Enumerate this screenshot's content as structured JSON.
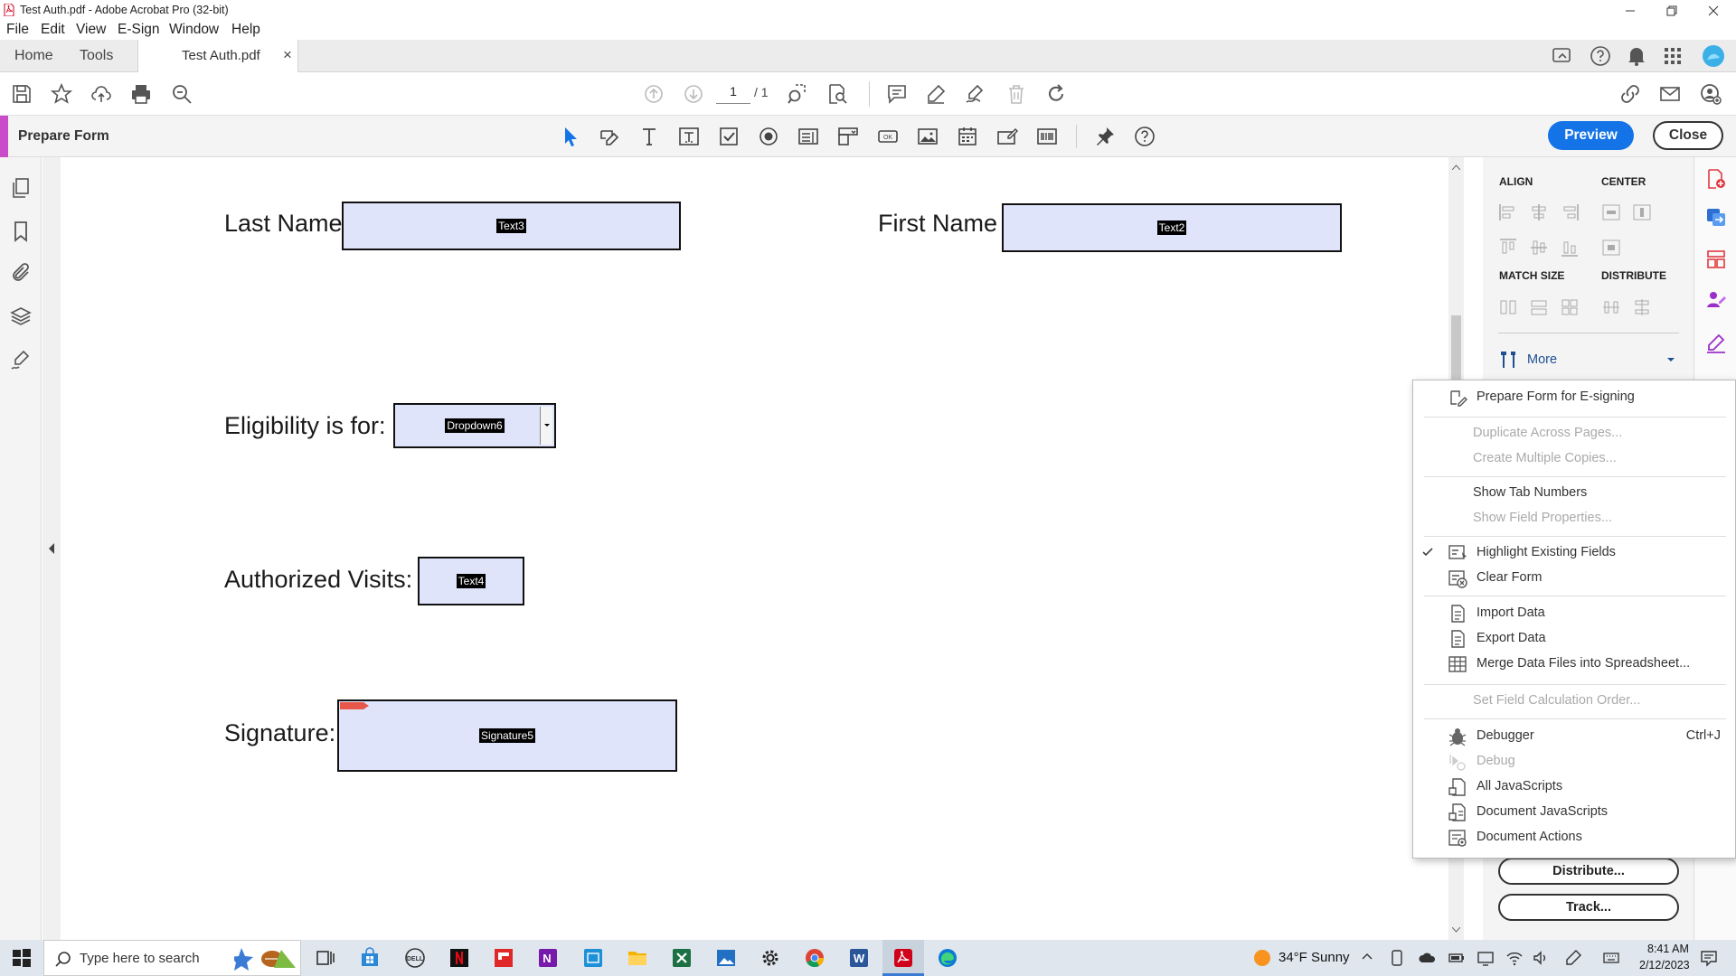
{
  "window": {
    "title": "Test Auth.pdf - Adobe Acrobat Pro (32-bit)"
  },
  "menubar": {
    "items": [
      "File",
      "Edit",
      "View",
      "E-Sign",
      "Window",
      "Help"
    ]
  },
  "tabs": {
    "home": "Home",
    "tools": "Tools",
    "document": "Test Auth.pdf",
    "close_glyph": "×"
  },
  "toolbar": {
    "page_current": "1",
    "page_total": "/ 1"
  },
  "prepare_form": {
    "label": "Prepare Form",
    "preview": "Preview",
    "close": "Close"
  },
  "document": {
    "fields": [
      {
        "label": "Last Name",
        "name": "Text3"
      },
      {
        "label": "First Name",
        "name": "Text2"
      },
      {
        "label": "Eligibility is for:",
        "name": "Dropdown6"
      },
      {
        "label": "Authorized Visits:",
        "name": "Text4"
      },
      {
        "label": "Signature:",
        "name": "Signature5"
      }
    ]
  },
  "right_panel": {
    "align": "ALIGN",
    "center": "CENTER",
    "match_size": "MATCH SIZE",
    "distribute": "DISTRIBUTE",
    "more": "More",
    "distribute_button": "Distribute...",
    "track_button": "Track..."
  },
  "menu": {
    "items": [
      {
        "label": "Prepare Form for E-signing",
        "enabled": true
      },
      {
        "label": "Duplicate Across Pages...",
        "enabled": false
      },
      {
        "label": "Create Multiple Copies...",
        "enabled": false
      },
      {
        "label": "Show Tab Numbers",
        "enabled": true
      },
      {
        "label": "Show Field Properties...",
        "enabled": false
      },
      {
        "label": "Highlight Existing Fields",
        "enabled": true,
        "checked": true
      },
      {
        "label": "Clear Form",
        "enabled": true
      },
      {
        "label": "Import Data",
        "enabled": true
      },
      {
        "label": "Export Data",
        "enabled": true
      },
      {
        "label": "Merge Data Files into Spreadsheet...",
        "enabled": true
      },
      {
        "label": "Set Field Calculation Order...",
        "enabled": false
      },
      {
        "label": "Debugger",
        "enabled": true,
        "shortcut": "Ctrl+J"
      },
      {
        "label": "Debug",
        "enabled": false
      },
      {
        "label": "All JavaScripts",
        "enabled": true
      },
      {
        "label": "Document JavaScripts",
        "enabled": true
      },
      {
        "label": "Document Actions",
        "enabled": true
      }
    ]
  },
  "taskbar": {
    "search_placeholder": "Type here to search",
    "weather": "34°F  Sunny",
    "time": "8:41 AM",
    "date": "2/12/2023"
  },
  "colors": {
    "accent": "#1473e6",
    "form_accent": "#c94dc9",
    "field_fill": "#dfe4fb"
  }
}
